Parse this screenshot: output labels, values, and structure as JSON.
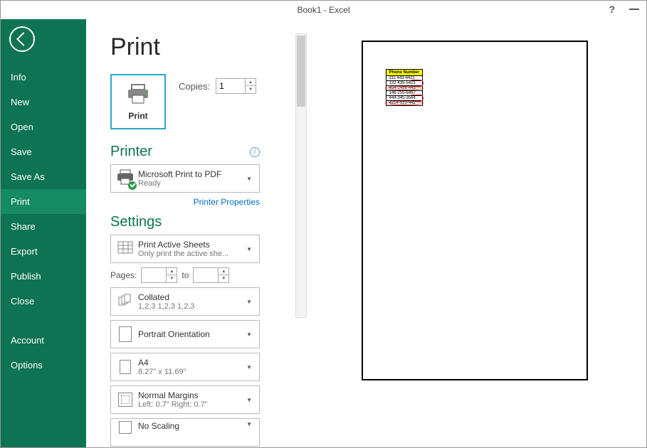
{
  "titlebar": {
    "title": "Book1 - Excel"
  },
  "sidebar": {
    "items": [
      {
        "label": "Info"
      },
      {
        "label": "New"
      },
      {
        "label": "Open"
      },
      {
        "label": "Save"
      },
      {
        "label": "Save As"
      },
      {
        "label": "Print"
      },
      {
        "label": "Share"
      },
      {
        "label": "Export"
      },
      {
        "label": "Publish"
      },
      {
        "label": "Close"
      }
    ],
    "footer": [
      {
        "label": "Account"
      },
      {
        "label": "Options"
      }
    ]
  },
  "page": {
    "title": "Print",
    "big_button_label": "Print",
    "copies_label": "Copies:",
    "copies_value": "1"
  },
  "printer": {
    "heading": "Printer",
    "selected_name": "Microsoft Print to PDF",
    "selected_status": "Ready",
    "properties_link": "Printer Properties"
  },
  "settings": {
    "heading": "Settings",
    "sheets": {
      "main": "Print Active Sheets",
      "sub": "Only print the active she..."
    },
    "pages_label": "Pages:",
    "pages_to": "to",
    "collated": {
      "main": "Collated",
      "sub": "1,2,3    1,2,3    1,2,3"
    },
    "orientation": {
      "main": "Portrait Orientation"
    },
    "paper": {
      "main": "A4",
      "sub": "8.27\" x 11.69\""
    },
    "margins": {
      "main": "Normal Margins",
      "sub": "Left:  0.7\"    Right:  0.7\""
    },
    "scaling": {
      "main": "No Scaling"
    }
  },
  "preview": {
    "header": "Phone Number",
    "rows": [
      {
        "val": "111-443-4421",
        "mark": "none"
      },
      {
        "val": "132-435-5421",
        "mark": "partial"
      },
      {
        "val": "454-2456-443",
        "mark": "full"
      },
      {
        "val": "146-255-6467",
        "mark": "none"
      },
      {
        "val": "444-345-3564",
        "mark": "partial"
      },
      {
        "val": "4214-533-442",
        "mark": "full"
      }
    ]
  }
}
